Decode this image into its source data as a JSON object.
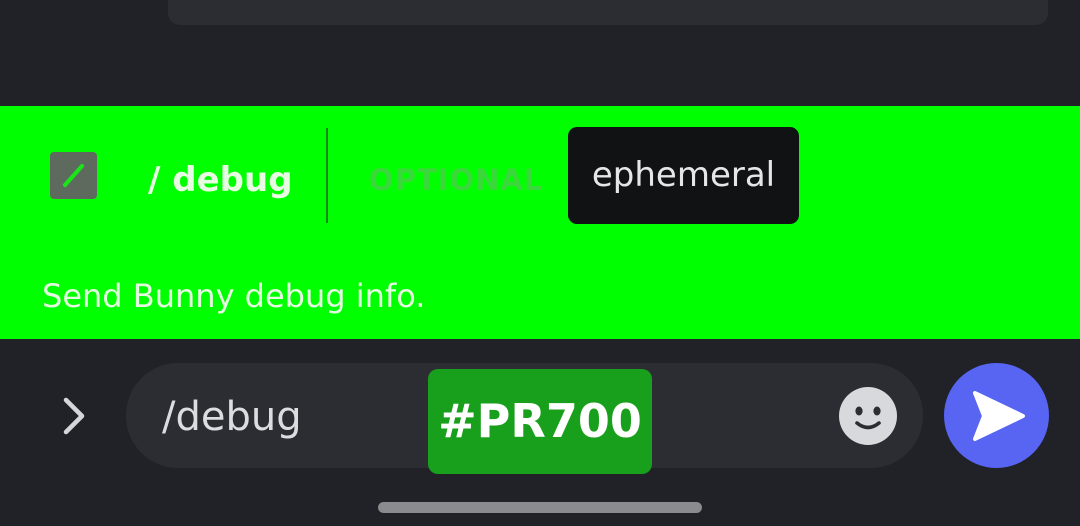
{
  "autocomplete": {
    "command_icon": "slash-command-icon",
    "command_name": "/ debug",
    "optional_label": "OPTIONAL",
    "option_name": "ephemeral",
    "description": "Send Bunny debug info."
  },
  "composer": {
    "expand_icon": "chevron-right-icon",
    "input_value": "/debug",
    "emoji_icon": "emoji-smile-icon",
    "send_icon": "send-arrow-icon"
  },
  "overlay_badge": {
    "label": "#PR700"
  },
  "colors": {
    "background": "#202227",
    "panel_highlight": "#00ff00",
    "option_chip": "#111214",
    "badge": "#189f1b",
    "send_button": "#5865f2"
  }
}
